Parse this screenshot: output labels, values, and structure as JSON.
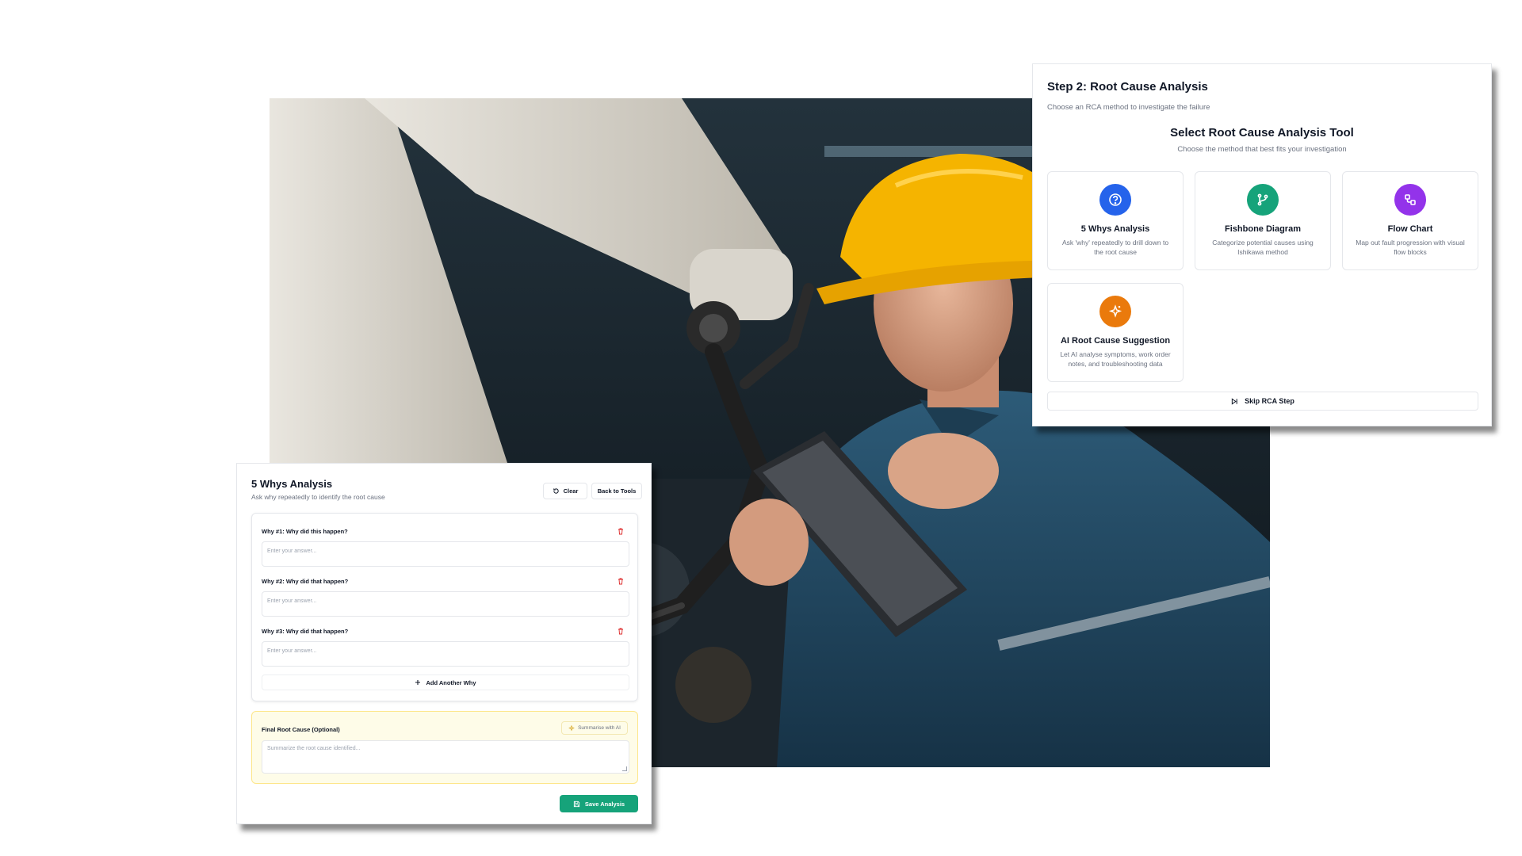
{
  "rca_card": {
    "step_title": "Step 2: Root Cause Analysis",
    "step_subtitle": "Choose an RCA method to investigate the failure",
    "select_title": "Select Root Cause Analysis Tool",
    "select_subtitle": "Choose the method that best fits your investigation",
    "tools": [
      {
        "name": "5 Whys Analysis",
        "description": "Ask 'why' repeatedly to drill down to the root cause",
        "icon": "question-circle-icon",
        "color": "#2563eb"
      },
      {
        "name": "Fishbone Diagram",
        "description": "Categorize potential causes using Ishikawa method",
        "icon": "git-branch-icon",
        "color": "#16a37a"
      },
      {
        "name": "Flow Chart",
        "description": "Map out fault progression with visual flow blocks",
        "icon": "flow-chart-icon",
        "color": "#9333ea"
      },
      {
        "name": "AI Root Cause Suggestion",
        "description": "Let AI analyse symptoms, work order notes, and troubleshooting data",
        "icon": "sparkles-icon",
        "color": "#ea7a0c"
      }
    ],
    "skip_label": "Skip RCA Step"
  },
  "whys_card": {
    "title": "5 Whys Analysis",
    "subtitle": "Ask why repeatedly to identify the root cause",
    "clear_label": "Clear",
    "back_label": "Back to Tools",
    "questions": [
      {
        "label": "Why #1: Why did this happen?",
        "placeholder": "Enter your answer..."
      },
      {
        "label": "Why #2: Why did that happen?",
        "placeholder": "Enter your answer..."
      },
      {
        "label": "Why #3: Why did that happen?",
        "placeholder": "Enter your answer..."
      }
    ],
    "add_label": "Add Another Why",
    "final_label": "Final Root Cause (Optional)",
    "summarise_label": "Summarise with AI",
    "final_placeholder": "Summarize the root cause identified...",
    "save_label": "Save Analysis"
  },
  "colors": {
    "accent_green": "#16a37a",
    "delete_red": "#dc2626",
    "final_bg": "#fefce8"
  }
}
